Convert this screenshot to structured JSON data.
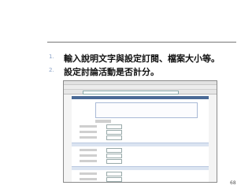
{
  "slide": {
    "items": [
      {
        "number": "1.",
        "text": "輸入說明文字與設定訂閱、檔案大小等。"
      },
      {
        "number": "2.",
        "text": "設定討論活動是否計分。"
      }
    ],
    "page_number": "68"
  }
}
